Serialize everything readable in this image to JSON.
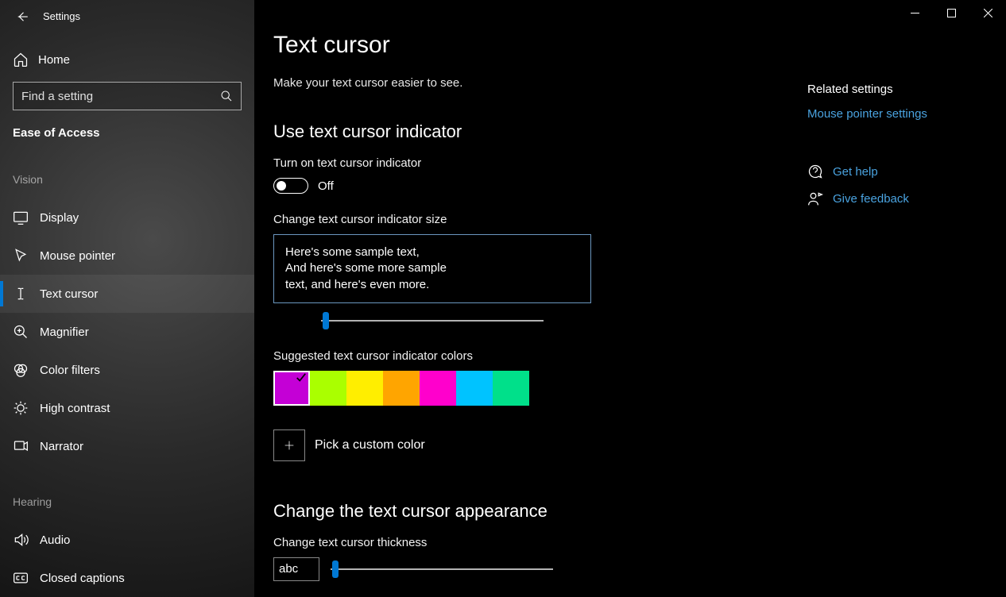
{
  "app": {
    "title": "Settings"
  },
  "home": {
    "label": "Home"
  },
  "search": {
    "placeholder": "Find a setting"
  },
  "category": {
    "label": "Ease of Access"
  },
  "groups": [
    {
      "label": "Vision",
      "items": [
        {
          "key": "display",
          "label": "Display"
        },
        {
          "key": "mouse-pointer",
          "label": "Mouse pointer"
        },
        {
          "key": "text-cursor",
          "label": "Text cursor",
          "selected": true
        },
        {
          "key": "magnifier",
          "label": "Magnifier"
        },
        {
          "key": "color-filters",
          "label": "Color filters"
        },
        {
          "key": "high-contrast",
          "label": "High contrast"
        },
        {
          "key": "narrator",
          "label": "Narrator"
        }
      ]
    },
    {
      "label": "Hearing",
      "items": [
        {
          "key": "audio",
          "label": "Audio"
        },
        {
          "key": "closed-captions",
          "label": "Closed captions"
        }
      ]
    }
  ],
  "page": {
    "title": "Text cursor",
    "subtitle": "Make your text cursor easier to see."
  },
  "indicator": {
    "heading": "Use text cursor indicator",
    "toggle_label": "Turn on text cursor indicator",
    "toggle_state": "Off",
    "size_label": "Change text cursor indicator size",
    "sample_line1": "Here's some sample text,",
    "sample_line2": "And here's some more sample",
    "sample_line3": "text, and here's even more.",
    "colors_label": "Suggested text cursor indicator colors",
    "colors": [
      {
        "hex": "#c400d6",
        "selected": true
      },
      {
        "hex": "#aaff00"
      },
      {
        "hex": "#ffee00"
      },
      {
        "hex": "#ffa500"
      },
      {
        "hex": "#ff00cc"
      },
      {
        "hex": "#00c3ff"
      },
      {
        "hex": "#00e08a"
      }
    ],
    "custom_label": "Pick a custom color"
  },
  "appearance": {
    "heading": "Change the text cursor appearance",
    "thickness_label": "Change text cursor thickness",
    "preview_text": "abc"
  },
  "related": {
    "heading": "Related settings",
    "link": "Mouse pointer settings",
    "help": "Get help",
    "feedback": "Give feedback"
  }
}
